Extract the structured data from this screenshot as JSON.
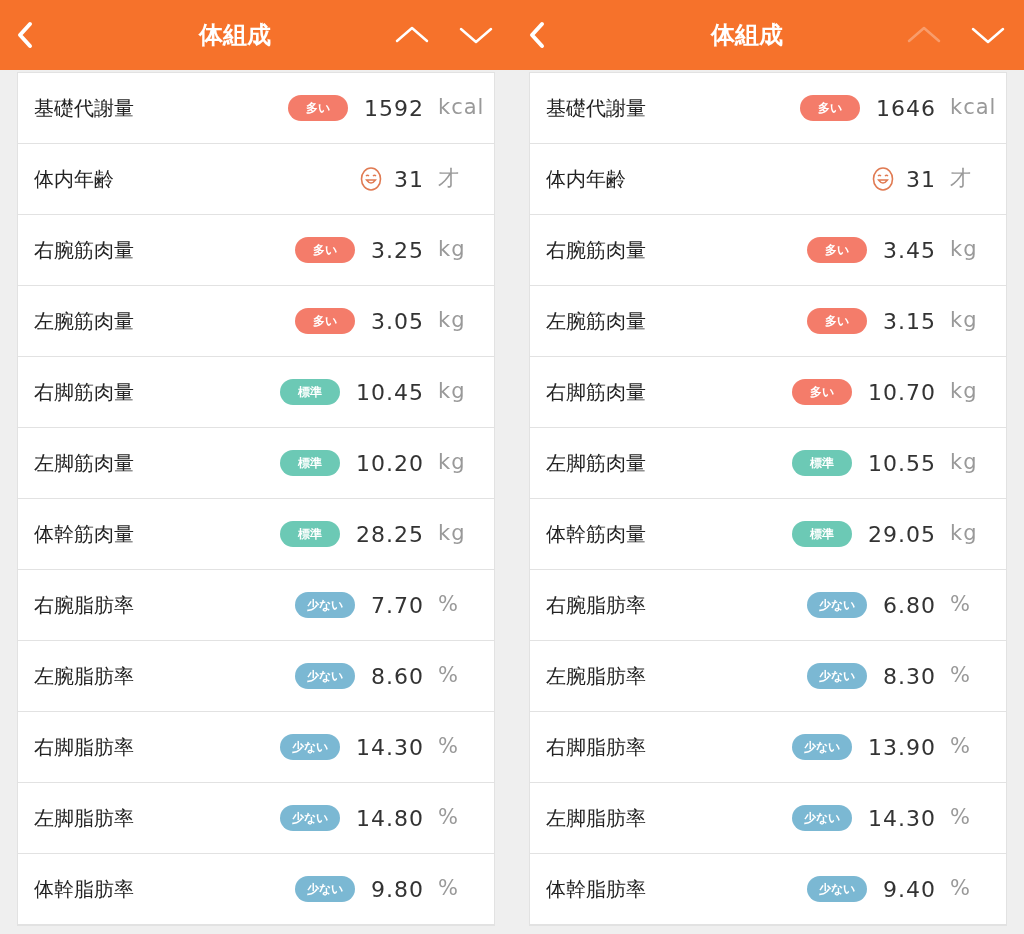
{
  "screens": [
    {
      "title": "体組成",
      "nav": {
        "up_disabled": false,
        "down_disabled": false
      },
      "rows": [
        {
          "label": "基礎代謝量",
          "indicator": {
            "kind": "high",
            "text": "多い"
          },
          "value": "1592",
          "unit": "kcal"
        },
        {
          "label": "体内年齢",
          "indicator": {
            "kind": "face"
          },
          "value": "31",
          "unit": "才"
        },
        {
          "label": "右腕筋肉量",
          "indicator": {
            "kind": "high",
            "text": "多い"
          },
          "value": "3.25",
          "unit": "kg"
        },
        {
          "label": "左腕筋肉量",
          "indicator": {
            "kind": "high",
            "text": "多い"
          },
          "value": "3.05",
          "unit": "kg"
        },
        {
          "label": "右脚筋肉量",
          "indicator": {
            "kind": "normal",
            "text": "標準"
          },
          "value": "10.45",
          "unit": "kg"
        },
        {
          "label": "左脚筋肉量",
          "indicator": {
            "kind": "normal",
            "text": "標準"
          },
          "value": "10.20",
          "unit": "kg"
        },
        {
          "label": "体幹筋肉量",
          "indicator": {
            "kind": "normal",
            "text": "標準"
          },
          "value": "28.25",
          "unit": "kg"
        },
        {
          "label": "右腕脂肪率",
          "indicator": {
            "kind": "low",
            "text": "少ない"
          },
          "value": "7.70",
          "unit": "%"
        },
        {
          "label": "左腕脂肪率",
          "indicator": {
            "kind": "low",
            "text": "少ない"
          },
          "value": "8.60",
          "unit": "%"
        },
        {
          "label": "右脚脂肪率",
          "indicator": {
            "kind": "low",
            "text": "少ない"
          },
          "value": "14.30",
          "unit": "%"
        },
        {
          "label": "左脚脂肪率",
          "indicator": {
            "kind": "low",
            "text": "少ない"
          },
          "value": "14.80",
          "unit": "%"
        },
        {
          "label": "体幹脂肪率",
          "indicator": {
            "kind": "low",
            "text": "少ない"
          },
          "value": "9.80",
          "unit": "%"
        }
      ]
    },
    {
      "title": "体組成",
      "nav": {
        "up_disabled": true,
        "down_disabled": false
      },
      "rows": [
        {
          "label": "基礎代謝量",
          "indicator": {
            "kind": "high",
            "text": "多い"
          },
          "value": "1646",
          "unit": "kcal"
        },
        {
          "label": "体内年齢",
          "indicator": {
            "kind": "face"
          },
          "value": "31",
          "unit": "才"
        },
        {
          "label": "右腕筋肉量",
          "indicator": {
            "kind": "high",
            "text": "多い"
          },
          "value": "3.45",
          "unit": "kg"
        },
        {
          "label": "左腕筋肉量",
          "indicator": {
            "kind": "high",
            "text": "多い"
          },
          "value": "3.15",
          "unit": "kg"
        },
        {
          "label": "右脚筋肉量",
          "indicator": {
            "kind": "high",
            "text": "多い"
          },
          "value": "10.70",
          "unit": "kg"
        },
        {
          "label": "左脚筋肉量",
          "indicator": {
            "kind": "normal",
            "text": "標準"
          },
          "value": "10.55",
          "unit": "kg"
        },
        {
          "label": "体幹筋肉量",
          "indicator": {
            "kind": "normal",
            "text": "標準"
          },
          "value": "29.05",
          "unit": "kg"
        },
        {
          "label": "右腕脂肪率",
          "indicator": {
            "kind": "low",
            "text": "少ない"
          },
          "value": "6.80",
          "unit": "%"
        },
        {
          "label": "左腕脂肪率",
          "indicator": {
            "kind": "low",
            "text": "少ない"
          },
          "value": "8.30",
          "unit": "%"
        },
        {
          "label": "右脚脂肪率",
          "indicator": {
            "kind": "low",
            "text": "少ない"
          },
          "value": "13.90",
          "unit": "%"
        },
        {
          "label": "左脚脂肪率",
          "indicator": {
            "kind": "low",
            "text": "少ない"
          },
          "value": "14.30",
          "unit": "%"
        },
        {
          "label": "体幹脂肪率",
          "indicator": {
            "kind": "low",
            "text": "少ない"
          },
          "value": "9.40",
          "unit": "%"
        }
      ]
    }
  ]
}
